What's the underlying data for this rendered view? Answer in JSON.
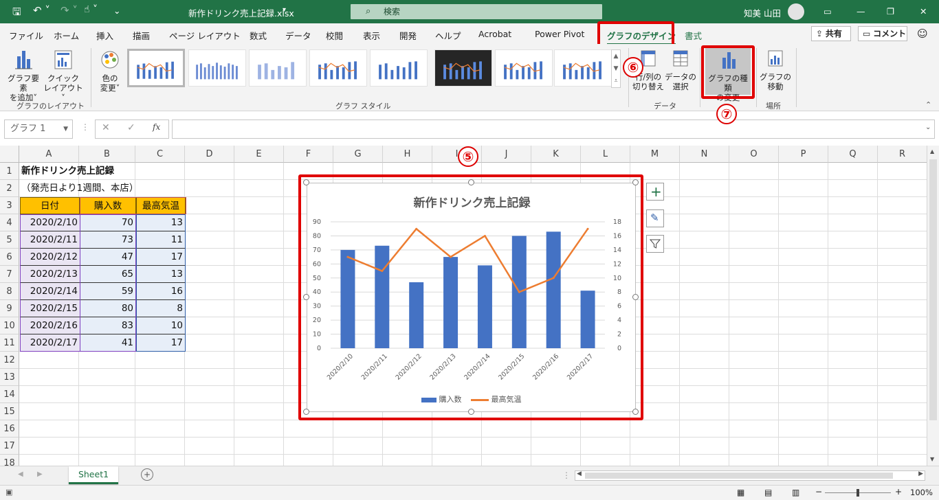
{
  "title_bar": {
    "file_name": "新作ドリンク売上記録.xlsx",
    "search_placeholder": "検索",
    "user_name": "知美 山田"
  },
  "tabs": [
    "ファイル",
    "ホーム",
    "挿入",
    "描画",
    "ページ レイアウト",
    "数式",
    "データ",
    "校閲",
    "表示",
    "開発",
    "ヘルプ",
    "Acrobat",
    "Power Pivot",
    "グラフのデザイン",
    "書式"
  ],
  "share_label": "共有",
  "comment_label": "コメント",
  "ribbon": {
    "add_element": [
      "グラフ要素",
      "を追加"
    ],
    "quick_layout": [
      "クイック",
      "レイアウト"
    ],
    "group_layout": "グラフのレイアウト",
    "change_color": [
      "色の",
      "変更"
    ],
    "group_styles": "グラフ スタイル",
    "switch_rowcol": [
      "行/列の",
      "切り替え"
    ],
    "select_data": [
      "データの",
      "選択"
    ],
    "group_data": "データ",
    "change_type": [
      "グラフの種類",
      "の変更"
    ],
    "move_chart": [
      "グラフの",
      "移動"
    ],
    "group_location": "場所"
  },
  "name_box": "グラフ 1",
  "fx_label": "fx",
  "columns": [
    "A",
    "B",
    "C",
    "D",
    "E",
    "F",
    "G",
    "H",
    "I",
    "J",
    "K",
    "L",
    "M",
    "N",
    "O",
    "P",
    "Q",
    "R"
  ],
  "rows": [
    "1",
    "2",
    "3",
    "4",
    "5",
    "6",
    "7",
    "8",
    "9",
    "10",
    "11",
    "12",
    "13",
    "14",
    "15",
    "16",
    "17",
    "18"
  ],
  "sheet": {
    "title": "新作ドリンク売上記録",
    "subtitle": "（発売日より1週間、本店）",
    "headers": [
      "日付",
      "購入数",
      "最高気温"
    ],
    "data": [
      [
        "2020/2/10",
        "70",
        "13"
      ],
      [
        "2020/2/11",
        "73",
        "11"
      ],
      [
        "2020/2/12",
        "47",
        "17"
      ],
      [
        "2020/2/13",
        "65",
        "13"
      ],
      [
        "2020/2/14",
        "59",
        "16"
      ],
      [
        "2020/2/15",
        "80",
        "8"
      ],
      [
        "2020/2/16",
        "83",
        "10"
      ],
      [
        "2020/2/17",
        "41",
        "17"
      ]
    ]
  },
  "chart_data": {
    "type": "bar",
    "title": "新作ドリンク売上記録",
    "categories": [
      "2020/2/10",
      "2020/2/11",
      "2020/2/12",
      "2020/2/13",
      "2020/2/14",
      "2020/2/15",
      "2020/2/16",
      "2020/2/17"
    ],
    "series": [
      {
        "name": "購入数",
        "type": "bar",
        "axis": "left",
        "color": "#4472c4",
        "values": [
          70,
          73,
          47,
          65,
          59,
          80,
          83,
          41
        ]
      },
      {
        "name": "最高気温",
        "type": "line",
        "axis": "right",
        "color": "#ed7d31",
        "values": [
          13,
          11,
          17,
          13,
          16,
          8,
          10,
          17
        ]
      }
    ],
    "ylim_left": [
      0,
      90
    ],
    "yticks_left": [
      "0",
      "10",
      "20",
      "30",
      "40",
      "50",
      "60",
      "70",
      "80",
      "90"
    ],
    "ylim_right": [
      0,
      18
    ],
    "yticks_right": [
      "0",
      "2",
      "4",
      "6",
      "8",
      "10",
      "12",
      "14",
      "16",
      "18"
    ],
    "legend": "bottom",
    "grid": true
  },
  "callouts": [
    "⑤",
    "⑥",
    "⑦"
  ],
  "sheet_tab": "Sheet1",
  "zoom": "100%",
  "colors": {
    "brand": "#217346",
    "highlight": "#e00000",
    "bar": "#4472c4",
    "line": "#ed7d31",
    "header_fill": "#ffc000"
  }
}
